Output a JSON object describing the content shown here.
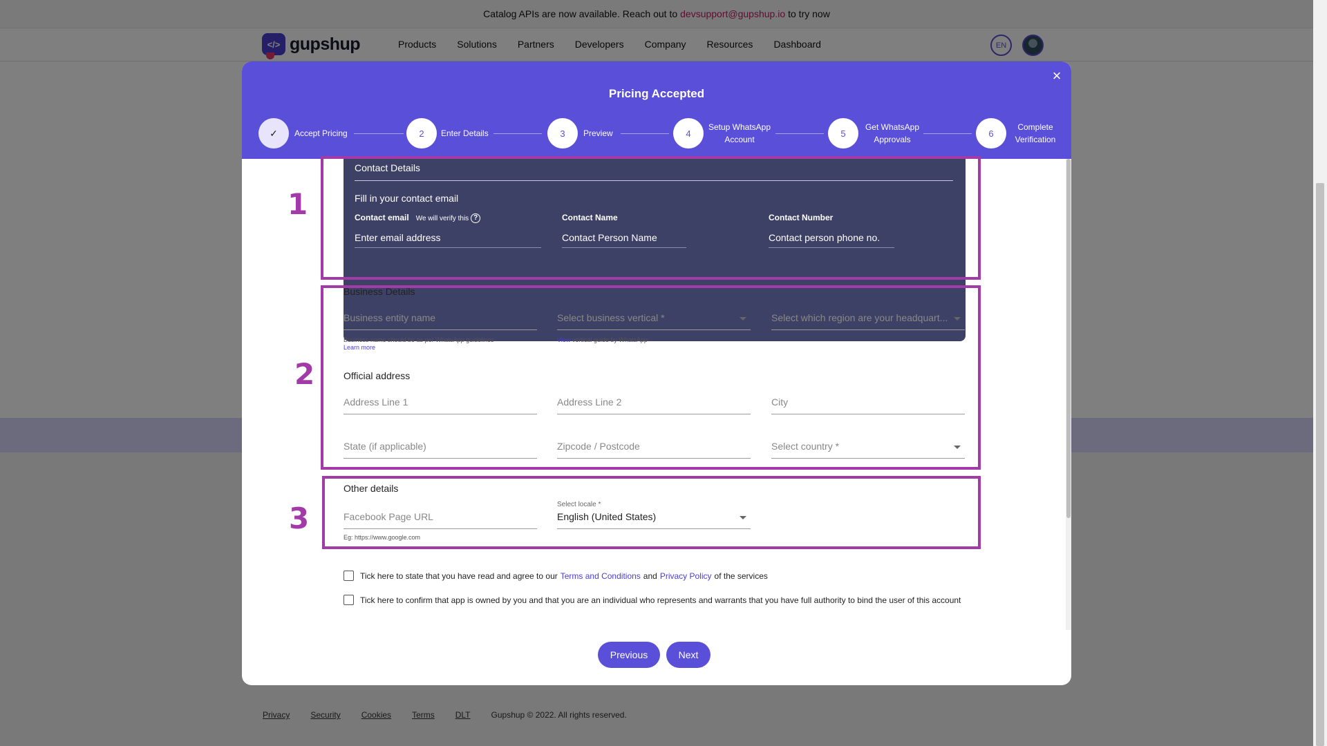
{
  "announcement": {
    "prefix": "Catalog APIs are now available. Reach out to",
    "email": "devsupport@gupshup.io",
    "suffix": "to try now"
  },
  "brand": {
    "name": "gupshup",
    "mark": "</>"
  },
  "nav": [
    "Products",
    "Solutions",
    "Partners",
    "Developers",
    "Company",
    "Resources",
    "Dashboard"
  ],
  "header": {
    "lang": "EN"
  },
  "modal": {
    "title": "Pricing Accepted",
    "close": "×",
    "steps": [
      {
        "num": "✓",
        "label": "Accept Pricing"
      },
      {
        "num": "2",
        "label": "Enter Details"
      },
      {
        "num": "3",
        "label": "Preview"
      },
      {
        "num": "4",
        "label": "Setup WhatsApp Account"
      },
      {
        "num": "5",
        "label": "Get WhatsApp Approvals"
      },
      {
        "num": "6",
        "label": "Complete Verification"
      }
    ]
  },
  "annotations": [
    "1",
    "2",
    "3"
  ],
  "contact": {
    "title": "Contact Details",
    "subtitle": "Fill in your contact email",
    "email_label": "Contact email",
    "email_hint": "We will verify this",
    "email_placeholder": "Enter email address",
    "name_label": "Contact Name",
    "name_placeholder": "Contact Person Name",
    "number_label": "Contact Number",
    "number_placeholder": "Contact person phone no."
  },
  "business": {
    "title": "Business Details",
    "entity_placeholder": "Business entity name",
    "entity_helper": "Business name should be as per WhatsApp guidelines",
    "learn_more": "Learn more",
    "vertical_placeholder": "Select business vertical *",
    "vertical_helper_link": "View",
    "vertical_helper": "vertical guide by WhatsApp",
    "region_placeholder": "Select which region are your headquart..."
  },
  "address": {
    "title": "Official address",
    "line1": "Address Line 1",
    "line2": "Address Line 2",
    "city": "City",
    "state": "State (if applicable)",
    "zip": "Zipcode / Postcode",
    "country": "Select country *"
  },
  "other": {
    "title": "Other details",
    "fb_placeholder": "Facebook Page URL",
    "fb_helper": "Eg: https://www.google.com",
    "locale_label": "Select locale *",
    "locale_value": "English (United States)"
  },
  "consent": {
    "terms_prefix": "Tick here to state that you have read and agree to our",
    "terms_link": "Terms and Conditions",
    "and": "and",
    "privacy_link": "Privacy Policy",
    "terms_suffix": "of the services",
    "ownership": "Tick here to confirm that app is owned by you and that you are an individual who represents and warrants that you have full authority to bind the user of this account"
  },
  "buttons": {
    "previous": "Previous",
    "next": "Next"
  },
  "footer": {
    "links": [
      "Privacy",
      "Security",
      "Cookies",
      "Terms",
      "DLT"
    ],
    "copyright": "Gupshup © 2022. All rights reserved."
  }
}
